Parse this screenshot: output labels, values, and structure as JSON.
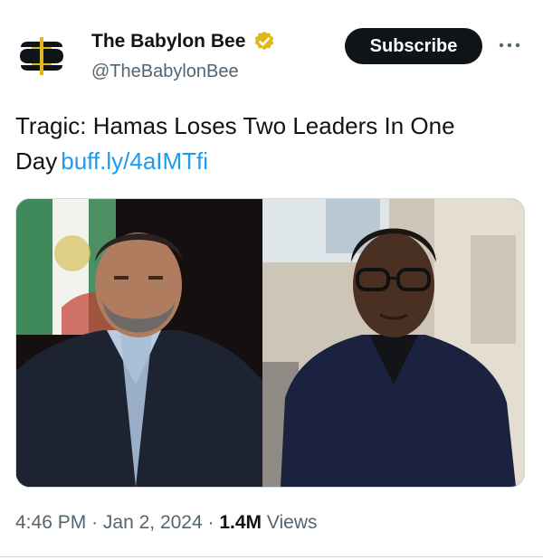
{
  "account": {
    "display_name": "The Babylon Bee",
    "handle": "@TheBabylonBee",
    "verified_badge": "gold-check-icon",
    "avatar_icon": "bee-logo-icon"
  },
  "actions": {
    "subscribe_label": "Subscribe",
    "more_icon": "more-horizontal-icon"
  },
  "post": {
    "text": "Tragic: Hamas Loses Two Leaders In One Day",
    "link": "buff.ly/4aIMTfi"
  },
  "media": {
    "images": [
      {
        "subject": "man-in-dark-suit-photo"
      },
      {
        "subject": "woman-in-navy-blazer-photo"
      }
    ]
  },
  "meta": {
    "time": "4:46 PM",
    "separator": "·",
    "date": "Jan 2, 2024",
    "views_count": "1.4M",
    "views_label": "Views"
  },
  "colors": {
    "text": "#0f1419",
    "secondary": "#536471",
    "link": "#1d9bf0",
    "verified_gold": "#e2b719",
    "button_bg": "#0f1419"
  }
}
